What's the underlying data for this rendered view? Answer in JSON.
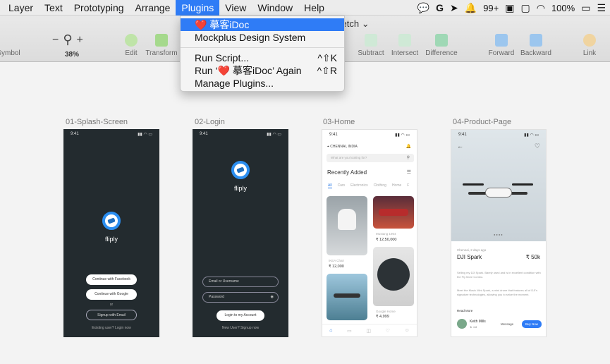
{
  "menubar": {
    "items": [
      "Layer",
      "Text",
      "Prototyping",
      "Arrange",
      "Plugins",
      "View",
      "Window",
      "Help"
    ],
    "active": "Plugins",
    "status": {
      "notifications": "99+",
      "battery": "100%"
    }
  },
  "toolbar": {
    "doc_title": "ketch",
    "zoom": "38%",
    "left_tools": [
      "Symbol",
      "Edit",
      "Transform"
    ],
    "right_tools": [
      "Subtract",
      "Intersect",
      "Difference",
      "Forward",
      "Backward",
      "Link"
    ]
  },
  "plugins_menu": {
    "items": [
      {
        "label": "摹客iDoc",
        "highlighted": true
      },
      {
        "label": "Mockplus Design System"
      },
      {
        "label": "Run Script...",
        "shortcut": "^⇧K"
      },
      {
        "label": "Run ‘",
        "label_tail": " 摹客iDoc’ Again",
        "shortcut": "^⇧R"
      },
      {
        "label": "Manage Plugins..."
      }
    ]
  },
  "artboards": [
    {
      "name": "01-Splash-Screen",
      "time": "9:41",
      "brand": "fliply",
      "buttons": [
        "Continue with Facebook",
        "Continue with Google",
        "Signup with Email"
      ],
      "or": "or",
      "footer": "Existing user? Login now"
    },
    {
      "name": "02-Login",
      "time": "9:41",
      "brand": "fliply",
      "fields": [
        "Email or Username",
        "Password"
      ],
      "button": "Login to my Account",
      "footer": "New User? Signup now"
    },
    {
      "name": "03-Home",
      "time": "9:41",
      "location": "CHENNAI, INDIA",
      "search_placeholder": "What are you looking for?",
      "section_title": "Recently Added",
      "tabs": [
        "All",
        "Cars",
        "Electronics",
        "Clothing",
        "Home",
        "F"
      ],
      "items": [
        {
          "caption": "IKEA Chair",
          "price": "₹ 12,000"
        },
        {
          "caption": "Mustang 1964",
          "price": "₹ 12,50,000"
        },
        {
          "caption": "Google Home",
          "price": "₹ 4,999"
        }
      ]
    },
    {
      "name": "04-Product-Page",
      "time": "9:41",
      "location": "Chennai, 2 days ago",
      "product": "DJI Spark",
      "price": "₹ 50k",
      "desc1": "Selling my DJI Spark. Barely used and is in excellent condition with the Fly More Combo.",
      "desc2": "Meet the Mavic Mini Spark, a mini drone that features all of DJI's signature technologies, allowing you to seize the moment.",
      "read_more": "Read More",
      "seller": "Keith Mills",
      "rating": "★ 4.8",
      "message": "Message",
      "buy": "Buy Now"
    }
  ],
  "colors": {
    "accent": "#2f7cf6",
    "dark_artboard": "#232b2f",
    "brand_blue": "#2b8ef0",
    "heart": "#e0283a"
  }
}
